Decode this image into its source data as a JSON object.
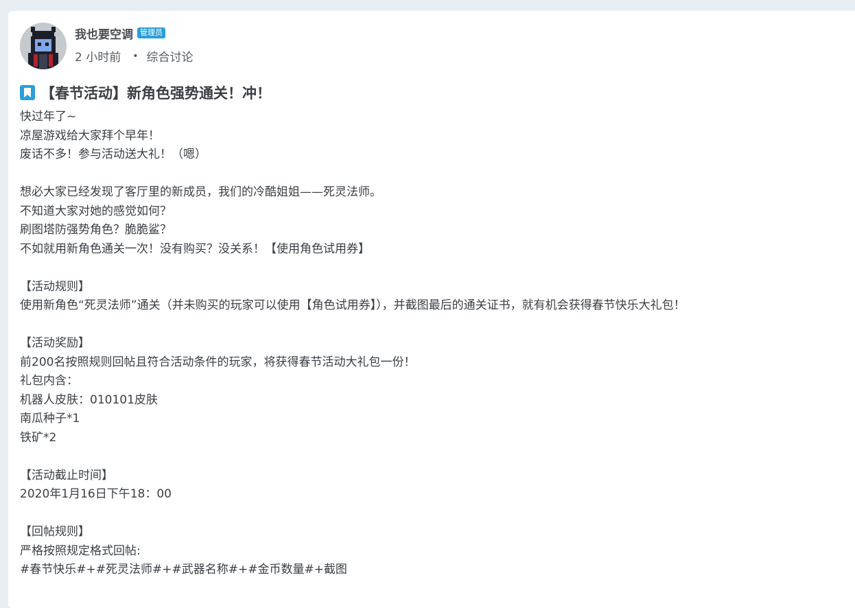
{
  "author": {
    "name": "我也要空调",
    "role": "管理员"
  },
  "meta": {
    "time": "2 小时前",
    "separator": "•",
    "category": "综合讨论"
  },
  "post": {
    "title": "【春节活动】新角色强势通关！冲！",
    "lines": [
      "快过年了~",
      "凉屋游戏给大家拜个早年！",
      "废话不多！参与活动送大礼！（嗯）",
      "",
      "想必大家已经发现了客厅里的新成员，我们的冷酷姐姐——死灵法师。",
      "不知道大家对她的感觉如何？",
      "刷图塔防强势角色？脆脆鲨？",
      "不如就用新角色通关一次！没有购买？没关系！【使用角色试用券】",
      "",
      "【活动规则】",
      "使用新角色“死灵法师”通关（并未购买的玩家可以使用【角色试用券】），并截图最后的通关证书，就有机会获得春节快乐大礼包！",
      "",
      "【活动奖励】",
      "前200名按照规则回帖且符合活动条件的玩家，将获得春节活动大礼包一份！",
      "礼包内含：",
      "机器人皮肤：010101皮肤",
      "南瓜种子*1",
      "铁矿*2",
      "",
      "【活动截止时间】",
      "2020年1月16日下午18：00",
      "",
      "【回帖规则】",
      "严格按照规定格式回帖:",
      "#春节快乐#+#死灵法师#+#武器名称#+#金币数量#+截图"
    ]
  },
  "colors": {
    "accent": "#2a9fd8",
    "background": "#e8eef2",
    "card": "#ffffff",
    "text": "#3a3f45"
  },
  "icons": {
    "title": "bookmark-icon",
    "avatar": "pixel-necromancer-avatar"
  }
}
